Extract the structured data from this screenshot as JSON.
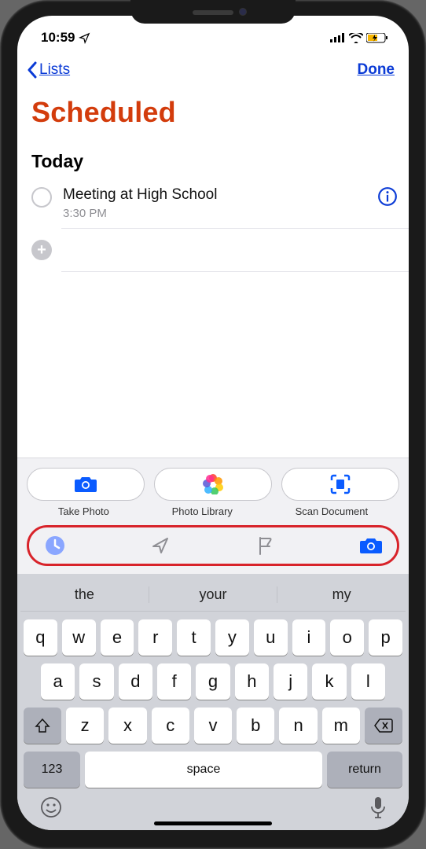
{
  "status": {
    "time": "10:59"
  },
  "nav": {
    "back_label": "Lists",
    "done_label": "Done"
  },
  "page": {
    "title": "Scheduled"
  },
  "section": {
    "header": "Today"
  },
  "reminders": [
    {
      "title": "Meeting at High School",
      "time": "3:30 PM"
    }
  ],
  "attach": {
    "take_photo": "Take Photo",
    "photo_library": "Photo Library",
    "scan_document": "Scan Document"
  },
  "suggestions": [
    "the",
    "your",
    "my"
  ],
  "keyboard": {
    "row1": [
      "q",
      "w",
      "e",
      "r",
      "t",
      "y",
      "u",
      "i",
      "o",
      "p"
    ],
    "row2": [
      "a",
      "s",
      "d",
      "f",
      "g",
      "h",
      "j",
      "k",
      "l"
    ],
    "row3": [
      "z",
      "x",
      "c",
      "v",
      "b",
      "n",
      "m"
    ],
    "numbers": "123",
    "space": "space",
    "return": "return"
  }
}
